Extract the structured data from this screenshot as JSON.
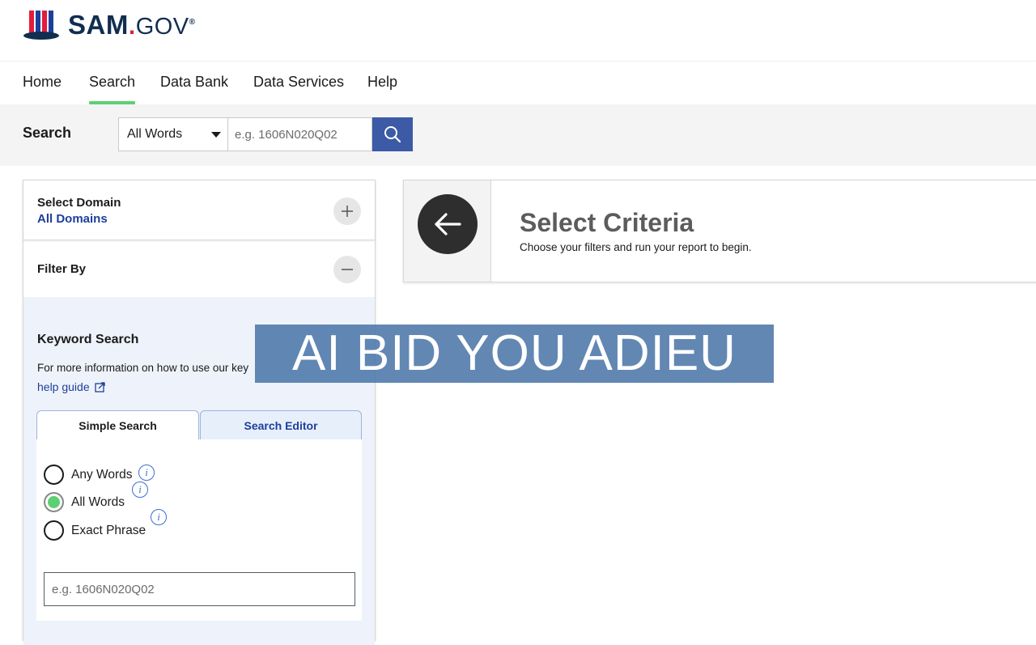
{
  "logo": {
    "brand": "SAM",
    "dot": ".",
    "gov": "GOV",
    "reg": "®",
    "flag_colors": [
      "#1d3f9c",
      "#e31c3d"
    ]
  },
  "nav": {
    "items": [
      {
        "label": "Home",
        "active": false
      },
      {
        "label": "Search",
        "active": true
      },
      {
        "label": "Data Bank",
        "active": false
      },
      {
        "label": "Data Services",
        "active": false
      },
      {
        "label": "Help",
        "active": false
      }
    ],
    "active_color": "#5cd073"
  },
  "searchbar": {
    "label": "Search",
    "select_value": "All Words",
    "placeholder": "e.g. 1606N020Q02",
    "button_icon": "search-icon",
    "button_color": "#3c5aa6"
  },
  "left_panel": {
    "domain": {
      "title": "Select Domain",
      "value": "All Domains",
      "toggle_icon": "plus-icon"
    },
    "filter": {
      "title": "Filter By",
      "toggle_icon": "minus-icon"
    },
    "keyword": {
      "title": "Keyword Search",
      "description": "For more information on how to use our key",
      "link": "help guide",
      "link_icon": "external-link-icon",
      "tabs": [
        {
          "label": "Simple Search",
          "active": true
        },
        {
          "label": "Search Editor",
          "active": false
        }
      ],
      "options": [
        {
          "label": "Any Words",
          "checked": false
        },
        {
          "label": "All Words",
          "checked": true
        },
        {
          "label": "Exact Phrase",
          "checked": false
        }
      ],
      "input_placeholder": "e.g. 1606N020Q02"
    }
  },
  "right_panel": {
    "back_icon": "arrow-left-icon",
    "title": "Select Criteria",
    "subtitle": "Choose your filters and run your report to begin."
  },
  "overlay": {
    "text": "AI BID YOU ADIEU"
  }
}
